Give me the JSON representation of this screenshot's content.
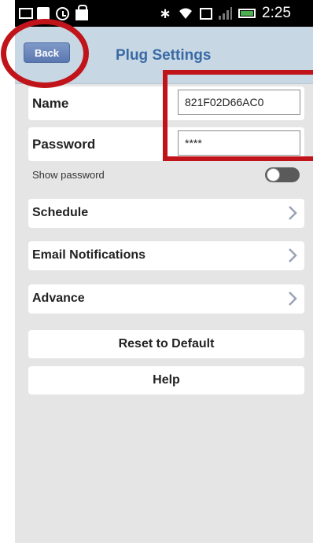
{
  "status_bar": {
    "time": "2:25",
    "icons": [
      "message-icon",
      "image-icon",
      "clock-icon",
      "bag-icon",
      "bluetooth-icon",
      "wifi-icon",
      "screenshot-icon",
      "signal-icon",
      "battery-icon"
    ],
    "battery_color": "#4caf50"
  },
  "header": {
    "back_label": "Back",
    "title": "Plug Settings"
  },
  "form": {
    "name_label": "Name",
    "name_value": "821F02D66AC0",
    "password_label": "Password",
    "password_value": "****",
    "show_password_label": "Show password",
    "show_password_on": false
  },
  "nav": {
    "schedule": "Schedule",
    "email": "Email Notifications",
    "advance": "Advance"
  },
  "actions": {
    "reset": "Reset to Default",
    "help": "Help"
  },
  "colors": {
    "header_bg": "#c7d7e3",
    "title": "#3a6aa6",
    "back_button": "#6a86bd",
    "annotation": "#c0141a"
  }
}
